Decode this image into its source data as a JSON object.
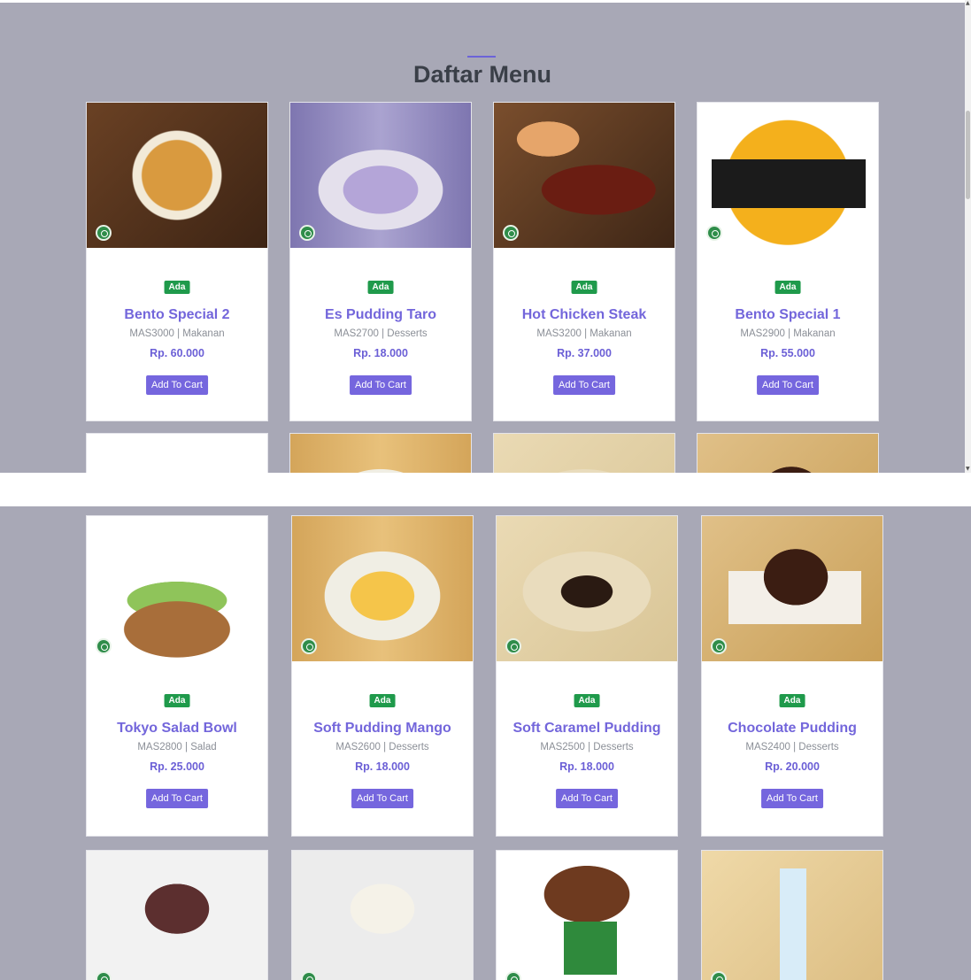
{
  "page": {
    "title": "Daftar Menu"
  },
  "colors": {
    "accent": "#7366db",
    "badge": "#1f9a4b",
    "background": "#a8a8b6"
  },
  "menu_items": [
    {
      "name": "Bento Special 2",
      "code": "MAS3000",
      "category": "Makanan",
      "price": "Rp. 60.000",
      "status": "Ada",
      "button": "Add To Cart"
    },
    {
      "name": "Es Pudding Taro",
      "code": "MAS2700",
      "category": "Desserts",
      "price": "Rp. 18.000",
      "status": "Ada",
      "button": "Add To Cart"
    },
    {
      "name": "Hot Chicken Steak",
      "code": "MAS3200",
      "category": "Makanan",
      "price": "Rp. 37.000",
      "status": "Ada",
      "button": "Add To Cart"
    },
    {
      "name": "Bento Special 1",
      "code": "MAS2900",
      "category": "Makanan",
      "price": "Rp. 55.000",
      "status": "Ada",
      "button": "Add To Cart"
    },
    {
      "name": "Tokyo Salad Bowl",
      "code": "MAS2800",
      "category": "Salad",
      "price": "Rp. 25.000",
      "status": "Ada",
      "button": "Add To Cart"
    },
    {
      "name": "Soft Pudding Mango",
      "code": "MAS2600",
      "category": "Desserts",
      "price": "Rp. 18.000",
      "status": "Ada",
      "button": "Add To Cart"
    },
    {
      "name": "Soft Caramel Pudding",
      "code": "MAS2500",
      "category": "Desserts",
      "price": "Rp. 18.000",
      "status": "Ada",
      "button": "Add To Cart"
    },
    {
      "name": "Chocolate Pudding",
      "code": "MAS2400",
      "category": "Desserts",
      "price": "Rp. 20.000",
      "status": "Ada",
      "button": "Add To Cart"
    }
  ],
  "icons": {
    "halal": "halal-logo-icon"
  }
}
